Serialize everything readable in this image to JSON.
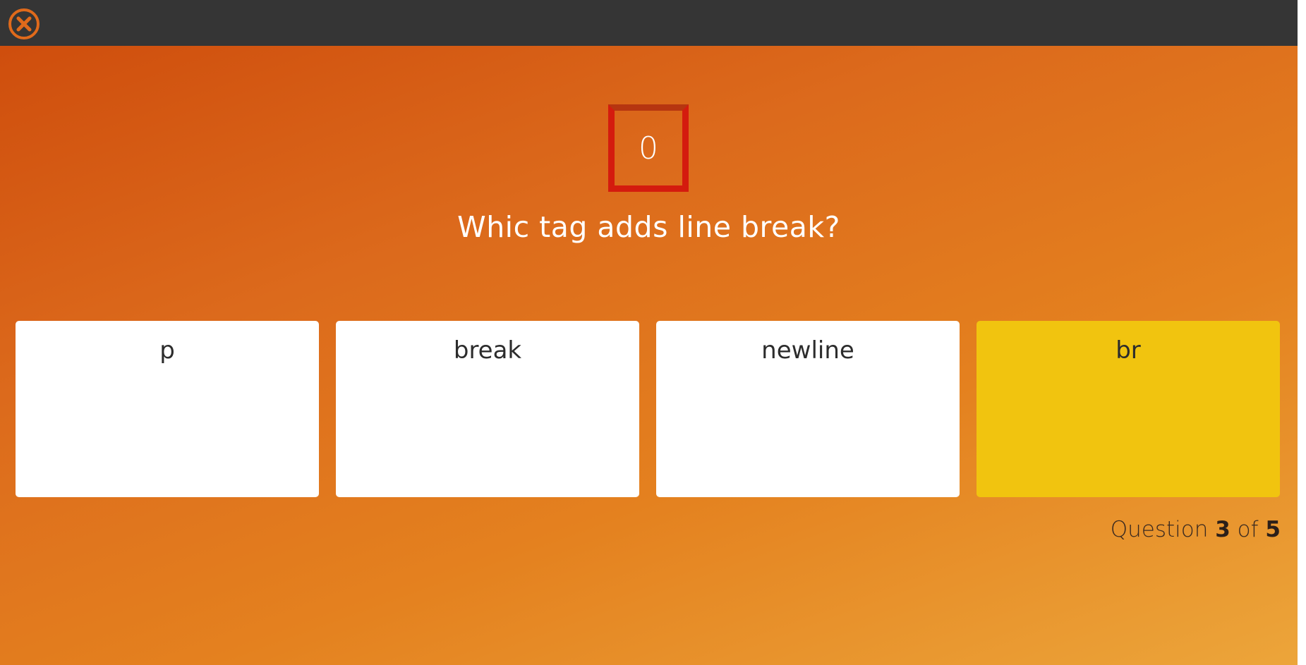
{
  "colors": {
    "topbar": "#353535",
    "accent": "#e06a1b",
    "timer_border": "#d41b0e",
    "answer_default": "#ffffff",
    "answer_selected": "#f1c40f"
  },
  "header": {
    "close_icon": "close-circle-icon"
  },
  "quiz": {
    "timer": "0",
    "question": "Whic tag adds line break?",
    "answers": [
      {
        "label": "p",
        "selected": false
      },
      {
        "label": "break",
        "selected": false
      },
      {
        "label": "newline",
        "selected": false
      },
      {
        "label": "br",
        "selected": true
      }
    ],
    "progress": {
      "prefix": "Question",
      "current": "3",
      "separator": "of",
      "total": "5"
    }
  }
}
